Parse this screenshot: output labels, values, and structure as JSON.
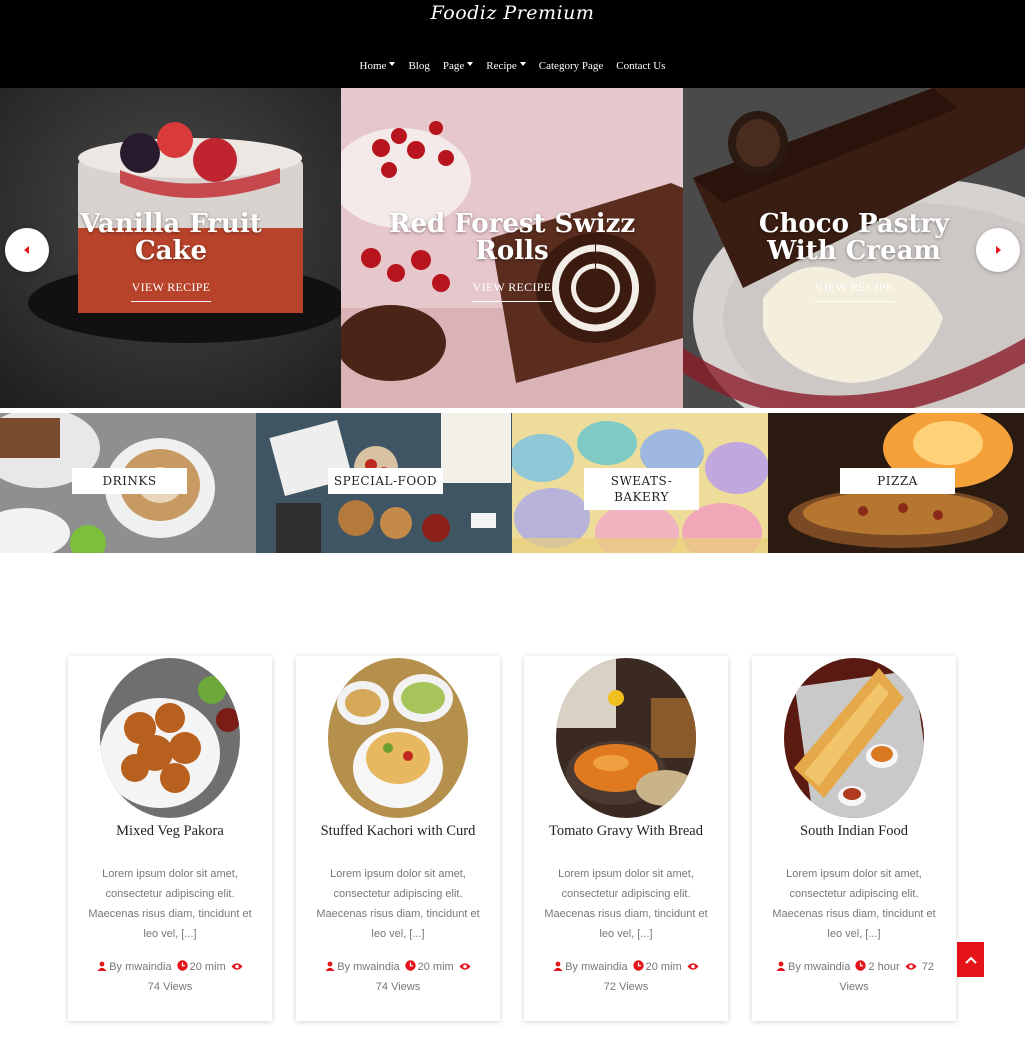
{
  "site": {
    "logo": "Foodiz Premium"
  },
  "nav": [
    {
      "label": "Home",
      "dropdown": true
    },
    {
      "label": "Blog",
      "dropdown": false
    },
    {
      "label": "Page",
      "dropdown": true
    },
    {
      "label": "Recipe",
      "dropdown": true
    },
    {
      "label": "Category Page",
      "dropdown": false
    },
    {
      "label": "Contact Us",
      "dropdown": false
    }
  ],
  "slider": {
    "slides": [
      {
        "title": "Vanilla Fruit Cake",
        "link": "VIEW RECIPE"
      },
      {
        "title": "Red Forest Swizz Rolls",
        "link": "VIEW RECIPE"
      },
      {
        "title": "Choco Pastry With Cream",
        "link": "VIEW RECIPE"
      }
    ],
    "prev_icon": "caret-left-icon",
    "next_icon": "caret-right-icon"
  },
  "categories": [
    "DRINKS",
    "SPECIAL-FOOD",
    "SWEATS-BAKERY",
    "PIZZA"
  ],
  "recipes": [
    {
      "title": "Mixed Veg Pakora",
      "excerpt": "Lorem ipsum dolor sit amet, consectetur adipiscing elit. Maecenas risus diam, tincidunt et leo vel, [...]",
      "author": "By mwaindia",
      "time": "20 mim",
      "views": "74 Views"
    },
    {
      "title": "Stuffed Kachori with Curd",
      "excerpt": "Lorem ipsum dolor sit amet, consectetur adipiscing elit. Maecenas risus diam, tincidunt et leo vel, [...]",
      "author": "By mwaindia",
      "time": "20 mim",
      "views": "74 Views"
    },
    {
      "title": "Tomato Gravy With Bread",
      "excerpt": "Lorem ipsum dolor sit amet, consectetur adipiscing elit. Maecenas risus diam, tincidunt et leo vel, [...]",
      "author": "By mwaindia",
      "time": "20 mim",
      "views": "72 Views"
    },
    {
      "title": "South Indian Food",
      "excerpt": "Lorem ipsum dolor sit amet, consectetur adipiscing elit. Maecenas risus diam, tincidunt et leo vel, [...]",
      "author": "By mwaindia",
      "time": "2 hour",
      "views": "72 Views"
    }
  ],
  "colors": {
    "accent": "#e5141b",
    "header_bg": "#000000",
    "text": "#222222",
    "muted": "#777777"
  },
  "icons": {
    "author": "user-icon",
    "time": "clock-icon",
    "views": "eye-icon",
    "to_top": "chevron-up-icon"
  }
}
